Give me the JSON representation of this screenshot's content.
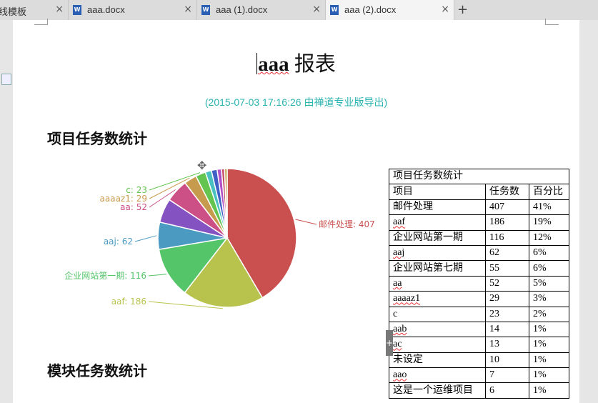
{
  "tabs": [
    {
      "label": "线模板",
      "active": false
    },
    {
      "label": "aaa.docx",
      "active": false
    },
    {
      "label": "aaa (1).docx",
      "active": false
    },
    {
      "label": "aaa (2).docx",
      "active": true
    }
  ],
  "tab_close_glyph": "×",
  "add_tab_glyph": "+",
  "doc": {
    "title_main": "aaa",
    "title_rest": " 报表",
    "subtitle": "(2015-07-03 17:16:26 由禅道专业版导出)",
    "section1": "项目任务数统计",
    "section2": "模块任务数统计"
  },
  "chart_data": {
    "type": "pie",
    "slices": [
      {
        "label": "邮件处理",
        "value": 407,
        "color": "#c9504f"
      },
      {
        "label": "aaf",
        "value": 186,
        "color": "#b8c34d"
      },
      {
        "label": "企业网站第一期",
        "value": 116,
        "color": "#55c56a"
      },
      {
        "label": "aaj",
        "value": 62,
        "color": "#4b9ac2"
      },
      {
        "label": "企业网站第七期",
        "value": 55,
        "color": "#8452c1"
      },
      {
        "label": "aa",
        "value": 52,
        "color": "#cc4f86"
      },
      {
        "label": "aaaaz1",
        "value": 29,
        "color": "#c79b4d"
      },
      {
        "label": "c",
        "value": 23,
        "color": "#63c450"
      },
      {
        "label": "aab",
        "value": 14,
        "color": "#4bc0c0"
      },
      {
        "label": "ac",
        "value": 13,
        "color": "#3f5fc6"
      },
      {
        "label": "未设定",
        "value": 10,
        "color": "#b04fc7"
      },
      {
        "label": "aao",
        "value": 7,
        "color": "#c54f6a"
      },
      {
        "label": "这是一个运维项目",
        "value": 6,
        "color": "#c4a44f"
      }
    ],
    "visible_labels": [
      "邮件处理: 407",
      "aaf: 186",
      "企业网站第一期: 116",
      "aaj: 62",
      "aa: 52",
      "aaaaz1: 29",
      "c: 23"
    ],
    "label_colors": [
      "#c9504f",
      "#b8c34d",
      "#55c56a",
      "#4b9ac2",
      "#cc4f86",
      "#c79b4d",
      "#63c450"
    ]
  },
  "table": {
    "caption": "项目任务数统计",
    "headers": [
      "项目",
      "任务数",
      "百分比"
    ],
    "rows": [
      [
        "邮件处理",
        "407",
        "41%"
      ],
      [
        "aaf",
        "186",
        "19%"
      ],
      [
        "企业网站第一期",
        "116",
        "12%"
      ],
      [
        "aaj",
        "62",
        "6%"
      ],
      [
        "企业网站第七期",
        "55",
        "6%"
      ],
      [
        "aa",
        "52",
        "5%"
      ],
      [
        "aaaaz1",
        "29",
        "3%"
      ],
      [
        "c",
        "23",
        "2%"
      ],
      [
        "aab",
        "14",
        "1%"
      ],
      [
        "ac",
        "13",
        "1%"
      ],
      [
        "未设定",
        "10",
        "1%"
      ],
      [
        "aao",
        "7",
        "1%"
      ],
      [
        "这是一个运维项目",
        "6",
        "1%"
      ]
    ]
  }
}
